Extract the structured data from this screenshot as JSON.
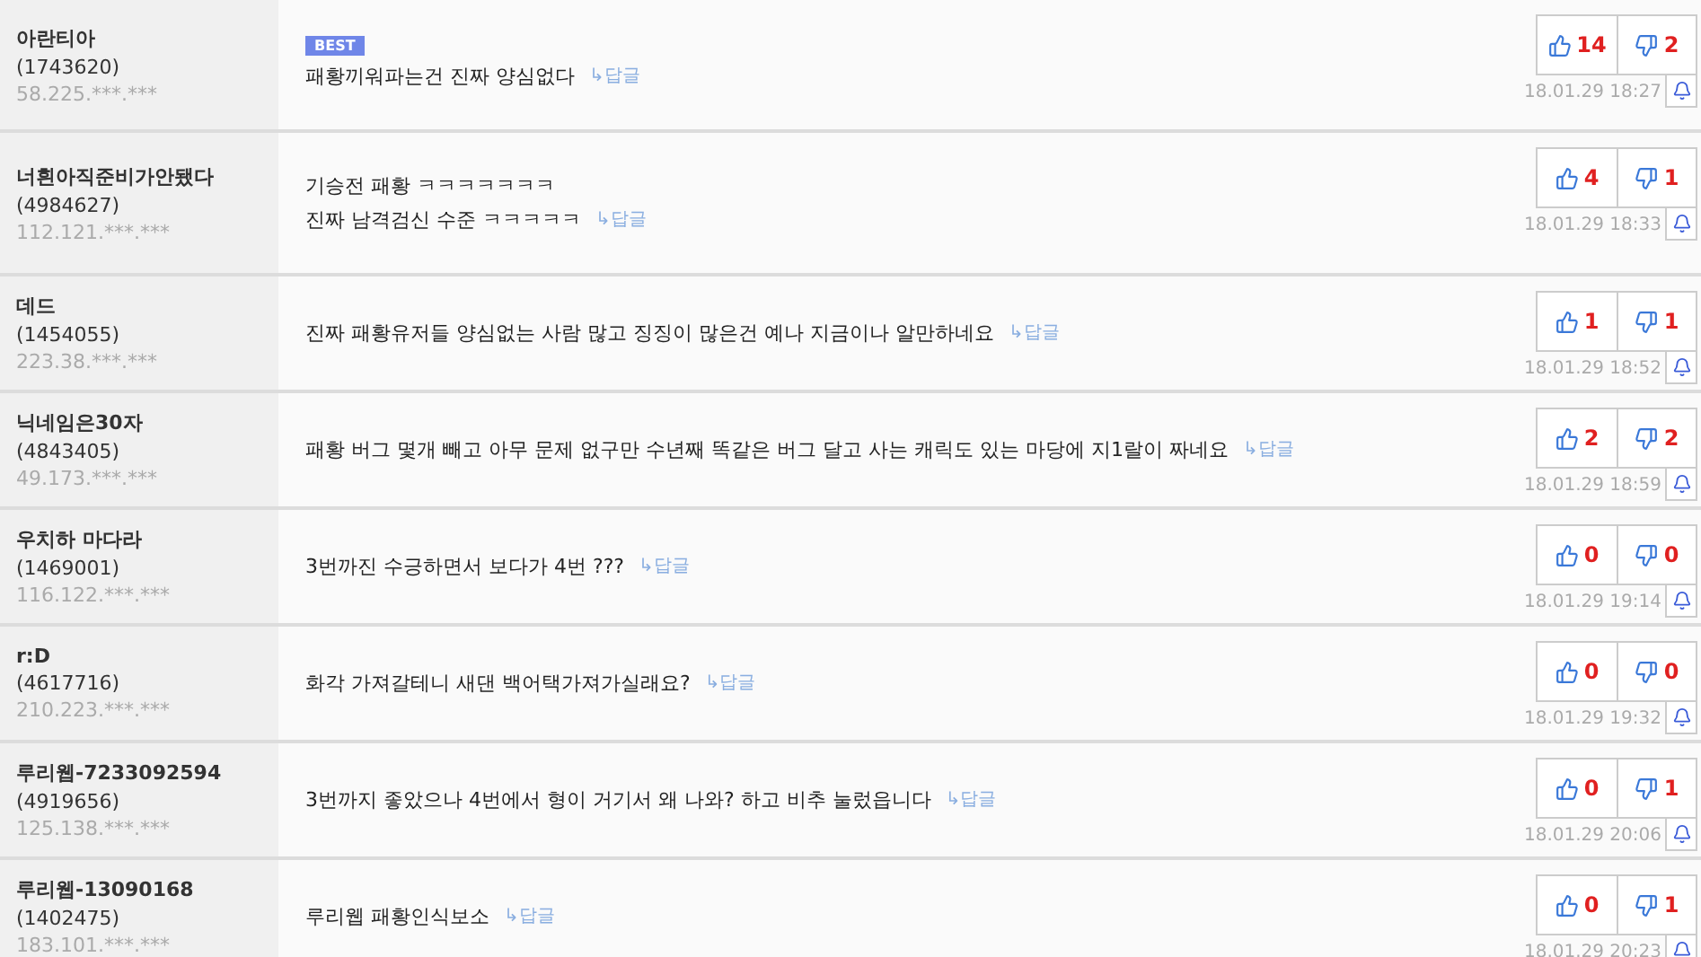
{
  "comments": [
    {
      "nickname": "아란티아",
      "user_id": "(1743620)",
      "ip": "58.225.***.***",
      "badge": "BEST",
      "lines": [
        "패황끼워파는건 진짜 양심없다"
      ],
      "reply": "↳답글",
      "likes": "14",
      "dislikes": "2",
      "time": "18.01.29 18:27"
    },
    {
      "nickname": "너흰아직준비가안됐다",
      "user_id": "(4984627)",
      "ip": "112.121.***.***",
      "lines": [
        "기승전 패황 ㅋㅋㅋㅋㅋㅋㅋ",
        "진짜 남격검신 수준 ㅋㅋㅋㅋㅋ"
      ],
      "reply": "↳답글",
      "likes": "4",
      "dislikes": "1",
      "time": "18.01.29 18:33"
    },
    {
      "nickname": "데드",
      "user_id": "(1454055)",
      "ip": "223.38.***.***",
      "lines": [
        "진짜 패황유저들 양심없는 사람 많고 징징이 많은건 예나 지금이나 알만하네요"
      ],
      "reply": "↳답글",
      "likes": "1",
      "dislikes": "1",
      "time": "18.01.29 18:52"
    },
    {
      "nickname": "닉네임은30자",
      "user_id": "(4843405)",
      "ip": "49.173.***.***",
      "lines": [
        "패황 버그 몇개 빼고 아무 문제 없구만 수년째 똑같은 버그 달고 사는 캐릭도 있는 마당에 지1랄이 짜네요"
      ],
      "reply": "↳답글",
      "likes": "2",
      "dislikes": "2",
      "time": "18.01.29 18:59"
    },
    {
      "nickname": "우치하 마다라",
      "user_id": "(1469001)",
      "ip": "116.122.***.***",
      "lines": [
        "3번까진 수긍하면서 보다가 4번 ???"
      ],
      "reply": "↳답글",
      "likes": "0",
      "dislikes": "0",
      "time": "18.01.29 19:14"
    },
    {
      "nickname": "r:D",
      "user_id": "(4617716)",
      "ip": "210.223.***.***",
      "lines": [
        "화각 가져갈테니 새댄 백어택가져가실래요?"
      ],
      "reply": "↳답글",
      "likes": "0",
      "dislikes": "0",
      "time": "18.01.29 19:32"
    },
    {
      "nickname": "루리웹-7233092594",
      "user_id": "(4919656)",
      "ip": "125.138.***.***",
      "lines": [
        "3번까지 좋았으나 4번에서 형이 거기서 왜 나와? 하고 비추 눌렀읍니다"
      ],
      "reply": "↳답글",
      "likes": "0",
      "dislikes": "1",
      "time": "18.01.29 20:06"
    },
    {
      "nickname": "루리웹-13090168",
      "user_id": "(1402475)",
      "ip": "183.101.***.***",
      "lines": [
        "루리웹 패황인식보소"
      ],
      "reply": "↳답글",
      "likes": "0",
      "dislikes": "1",
      "time": "18.01.29 20:23"
    }
  ]
}
